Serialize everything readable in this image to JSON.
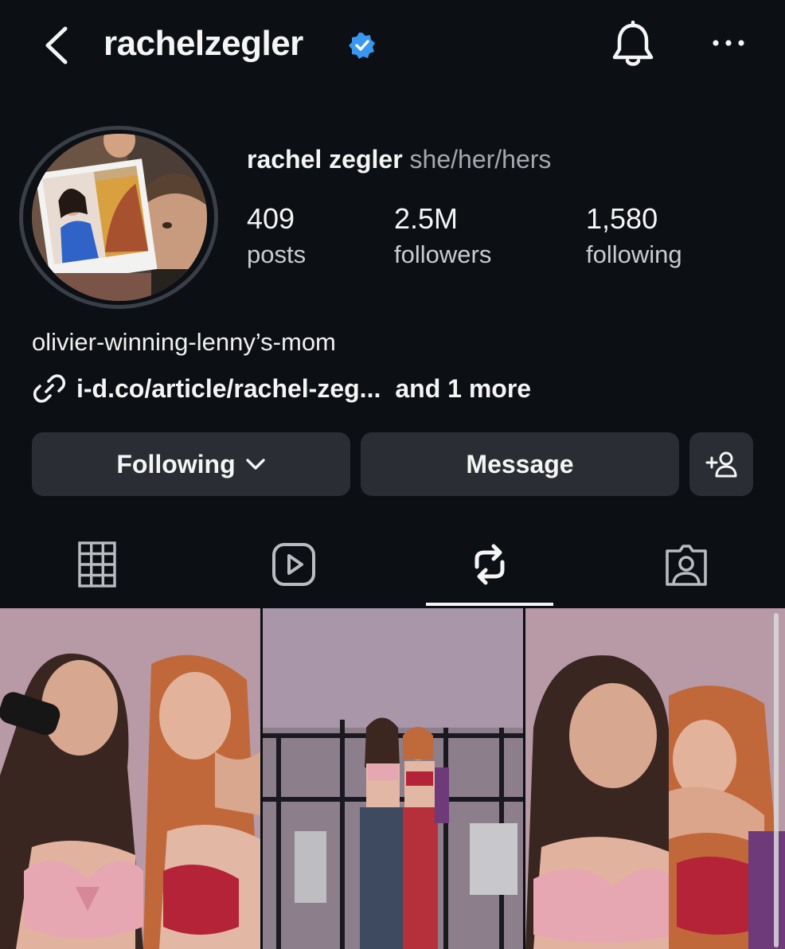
{
  "header": {
    "username": "rachelzegler",
    "back_icon": "chevron-left-icon",
    "verified_icon": "verified-badge-icon",
    "bell_icon": "bell-icon",
    "more_icon": "more-dots-icon"
  },
  "profile": {
    "name": "rachel zegler",
    "pronouns": "she/her/hers",
    "stats": [
      {
        "value": "409",
        "label": "posts"
      },
      {
        "value": "2.5M",
        "label": "followers"
      },
      {
        "value": "1,580",
        "label": "following"
      }
    ],
    "bio": "olivier-winning-lenny’s-mom",
    "link": "i-d.co/article/rachel-zeg...",
    "link_more": "and 1 more"
  },
  "actions": {
    "following_label": "Following",
    "message_label": "Message",
    "add_user_label": "+"
  },
  "tabs": [
    {
      "icon": "grid-icon",
      "active": false
    },
    {
      "icon": "reels-icon",
      "active": false
    },
    {
      "icon": "reposts-icon",
      "active": true
    },
    {
      "icon": "tagged-icon",
      "active": false
    }
  ],
  "colors": {
    "background": "#0c0f14",
    "button": "#2a2d33",
    "verified": "#3897f0",
    "text": "#f5f5f5",
    "muted": "#a5a8ae"
  }
}
